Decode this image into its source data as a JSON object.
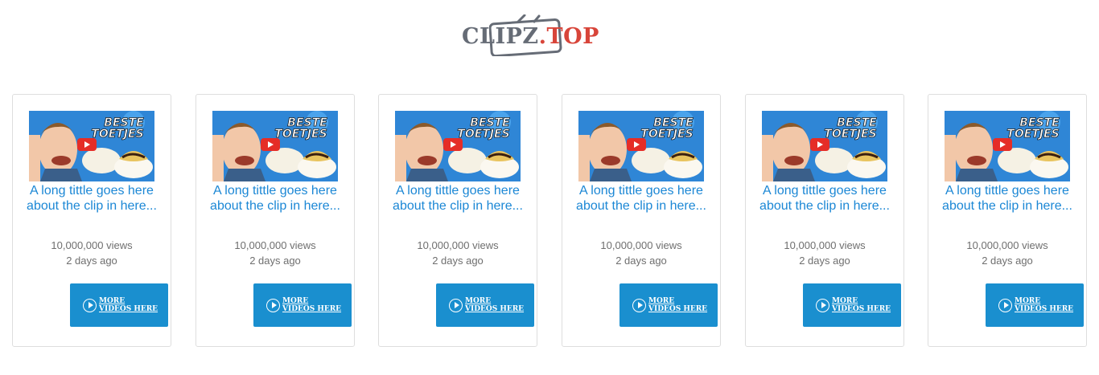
{
  "header": {
    "logo_part1": "CLIPZ",
    "logo_part2": ".TOP"
  },
  "colors": {
    "link_blue": "#1b87d5",
    "button_blue": "#1a8fcf",
    "logo_gray": "#666c76",
    "logo_red": "#d8453a"
  },
  "cards": [
    {
      "thumb_text_1": "BESTE",
      "thumb_text_2": "TOETJES",
      "title": "A long tittle goes here about the clip in here...",
      "views": "10,000,000 views",
      "ago": "2 days ago",
      "button_line1": "MORE",
      "button_line2": "VIDEOS HERE"
    },
    {
      "thumb_text_1": "BESTE",
      "thumb_text_2": "TOETJES",
      "title": "A long tittle goes here about the clip in here...",
      "views": "10,000,000 views",
      "ago": "2 days ago",
      "button_line1": "MORE",
      "button_line2": "VIDEOS HERE"
    },
    {
      "thumb_text_1": "BESTE",
      "thumb_text_2": "TOETJES",
      "title": "A long tittle goes here about the clip in here...",
      "views": "10,000,000 views",
      "ago": "2 days ago",
      "button_line1": "MORE",
      "button_line2": "VIDEOS HERE"
    },
    {
      "thumb_text_1": "BESTE",
      "thumb_text_2": "TOETJES",
      "title": "A long tittle goes here about the clip in here...",
      "views": "10,000,000 views",
      "ago": "2 days ago",
      "button_line1": "MORE",
      "button_line2": "VIDEOS HERE"
    },
    {
      "thumb_text_1": "BESTE",
      "thumb_text_2": "TOETJES",
      "title": "A long tittle goes here about the clip in here...",
      "views": "10,000,000 views",
      "ago": "2 days ago",
      "button_line1": "MORE",
      "button_line2": "VIDEOS HERE"
    },
    {
      "thumb_text_1": "BESTE",
      "thumb_text_2": "TOETJES",
      "title": "A long tittle goes here about the clip in here...",
      "views": "10,000,000 views",
      "ago": "2 days ago",
      "button_line1": "MORE",
      "button_line2": "VIDEOS HERE"
    }
  ]
}
